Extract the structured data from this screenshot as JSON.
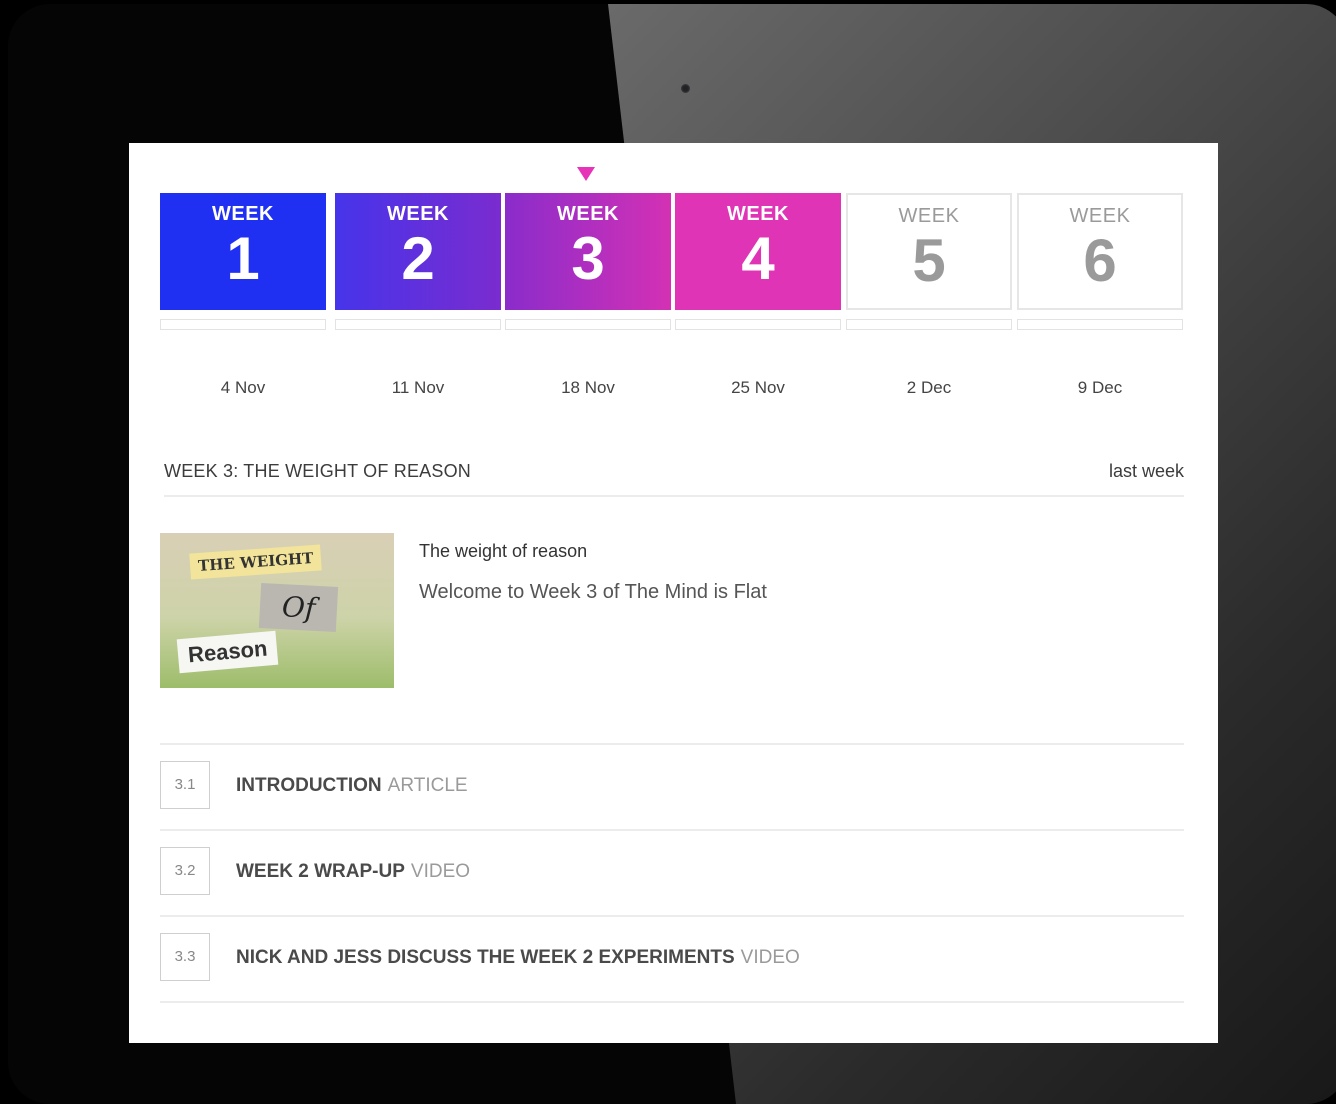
{
  "weeks": [
    {
      "label": "WEEK",
      "number": "1",
      "date": "4 Nov",
      "color": "#1f30f2",
      "status": "done"
    },
    {
      "label": "WEEK",
      "number": "2",
      "date": "11 Nov",
      "color": "#5a32dd",
      "status": "done"
    },
    {
      "label": "WEEK",
      "number": "3",
      "date": "18 Nov",
      "color": "#a22ac9",
      "status": "current"
    },
    {
      "label": "WEEK",
      "number": "4",
      "date": "25 Nov",
      "color": "#e034b6",
      "status": "done"
    },
    {
      "label": "WEEK",
      "number": "5",
      "date": "2 Dec",
      "color": "#ffffff",
      "status": "upcoming"
    },
    {
      "label": "WEEK",
      "number": "6",
      "date": "9 Dec",
      "color": "#ffffff",
      "status": "upcoming"
    }
  ],
  "colors": {
    "accent": "#e733b8",
    "current_marker": "#e733b8"
  },
  "section": {
    "title": "WEEK 3: THE WEIGHT OF REASON",
    "last_week_link": "last week"
  },
  "intro": {
    "image": {
      "line1": "THE WEIGHT",
      "line2": "Of",
      "line3": "Reason"
    },
    "title": "The weight of reason",
    "text": "Welcome to Week 3 of The Mind is Flat"
  },
  "steps": [
    {
      "number": "3.1",
      "title": "INTRODUCTION",
      "type": "ARTICLE"
    },
    {
      "number": "3.2",
      "title": "WEEK 2 WRAP-UP",
      "type": "VIDEO"
    },
    {
      "number": "3.3",
      "title": "NICK AND JESS DISCUSS THE WEEK 2 EXPERIMENTS",
      "type": "VIDEO"
    }
  ]
}
